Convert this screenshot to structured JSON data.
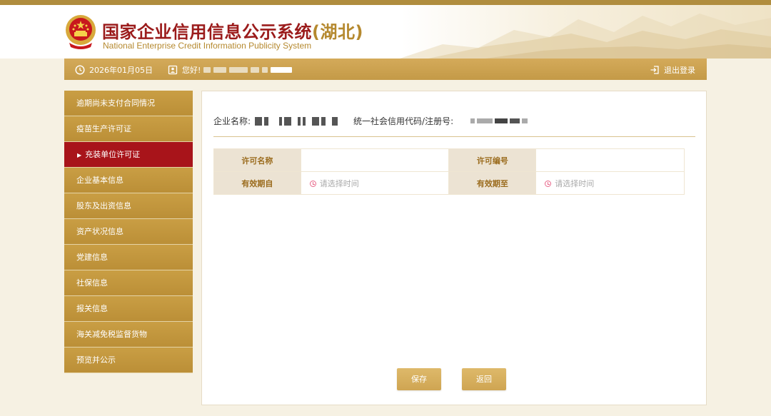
{
  "header": {
    "title_cn": "国家企业信用信息公示系统",
    "title_region": "(湖北)",
    "title_en": "National Enterprise Credit Information Publicity System"
  },
  "infobar": {
    "date": "2026年01月05日",
    "greeting": "您好!",
    "logout": "退出登录",
    "icons": {
      "clock": "clock-icon",
      "user": "user-icon",
      "logout": "logout-icon"
    }
  },
  "sidebar": {
    "items": [
      {
        "label": "逾期尚未支付合同情况"
      },
      {
        "label": "疫苗生产许可证"
      },
      {
        "label": "充装单位许可证",
        "active": true
      },
      {
        "label": "企业基本信息"
      },
      {
        "label": "股东及出资信息"
      },
      {
        "label": "资产状况信息"
      },
      {
        "label": "党建信息"
      },
      {
        "label": "社保信息"
      },
      {
        "label": "报关信息"
      },
      {
        "label": "海关减免税监督货物"
      },
      {
        "label": "预览并公示"
      }
    ]
  },
  "main": {
    "company_label": "企业名称:",
    "credit_code_label": "统一社会信用代码/注册号:",
    "form": {
      "license_name_label": "许可名称",
      "license_no_label": "许可编号",
      "valid_from_label": "有效期自",
      "valid_to_label": "有效期至",
      "valid_from_placeholder": "请选择时间",
      "valid_to_placeholder": "请选择时间"
    },
    "buttons": {
      "save": "保存",
      "back": "返回"
    }
  },
  "colors": {
    "brand_gold": "#c49a47",
    "active_red": "#a8141a",
    "title_red": "#9b1b1b",
    "label_bg": "#ece3d3"
  }
}
